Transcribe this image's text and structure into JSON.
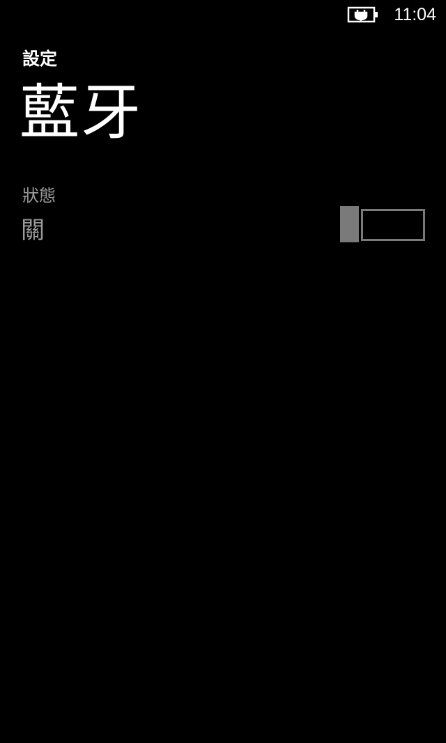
{
  "status_bar": {
    "time": "11:04",
    "battery_icon": "battery-charging-icon"
  },
  "header": {
    "app_title": "設定",
    "page_title": "藍牙"
  },
  "settings": {
    "status": {
      "label": "狀態",
      "value": "關",
      "on": false
    }
  },
  "colors": {
    "background": "#000000",
    "text_primary": "#ffffff",
    "text_secondary": "#9a9a9a",
    "toggle_off": "#7a7a7a"
  }
}
